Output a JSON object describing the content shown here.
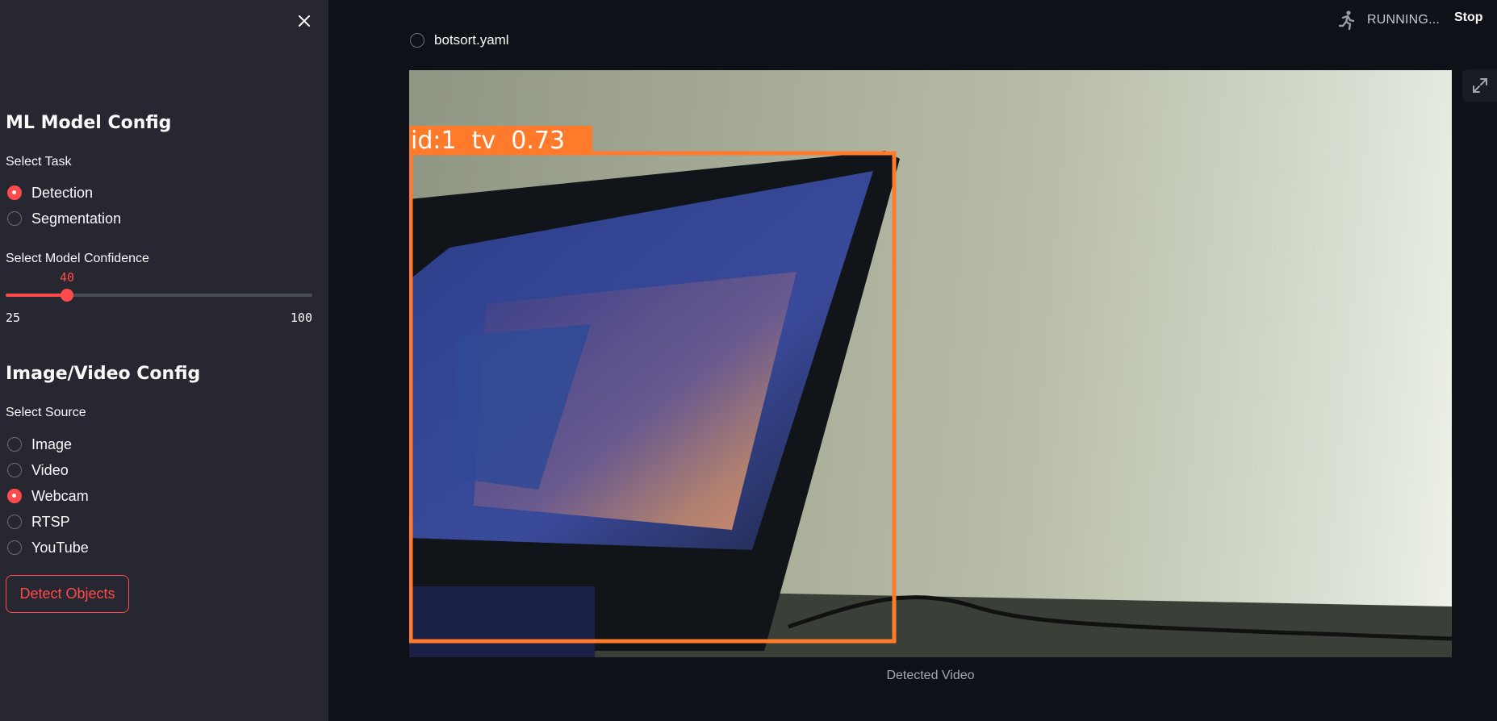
{
  "colors": {
    "accent": "#ff4b4b",
    "sidebar_bg": "#262730",
    "main_bg": "#0e1117",
    "bbox": "#ff7a2a"
  },
  "sidebar": {
    "close_icon": "close-icon",
    "model_config_title": "ML Model Config",
    "task_label": "Select Task",
    "tasks": [
      {
        "label": "Detection",
        "selected": true
      },
      {
        "label": "Segmentation",
        "selected": false
      }
    ],
    "confidence_label": "Select Model Confidence",
    "confidence": {
      "value": "40",
      "min": "25",
      "max": "100"
    },
    "source_config_title": "Image/Video Config",
    "source_label": "Select Source",
    "sources": [
      {
        "label": "Image",
        "selected": false
      },
      {
        "label": "Video",
        "selected": false
      },
      {
        "label": "Webcam",
        "selected": true
      },
      {
        "label": "RTSP",
        "selected": false
      },
      {
        "label": "YouTube",
        "selected": false
      }
    ],
    "detect_button": "Detect Objects"
  },
  "header": {
    "status_icon": "running-person-icon",
    "status_text": "RUNNING...",
    "stop_label": "Stop"
  },
  "main": {
    "tracker_option": "botsort.yaml",
    "detection": {
      "label": "id:1  tv  0.73"
    },
    "expand_icon": "fullscreen-icon",
    "caption": "Detected Video"
  }
}
